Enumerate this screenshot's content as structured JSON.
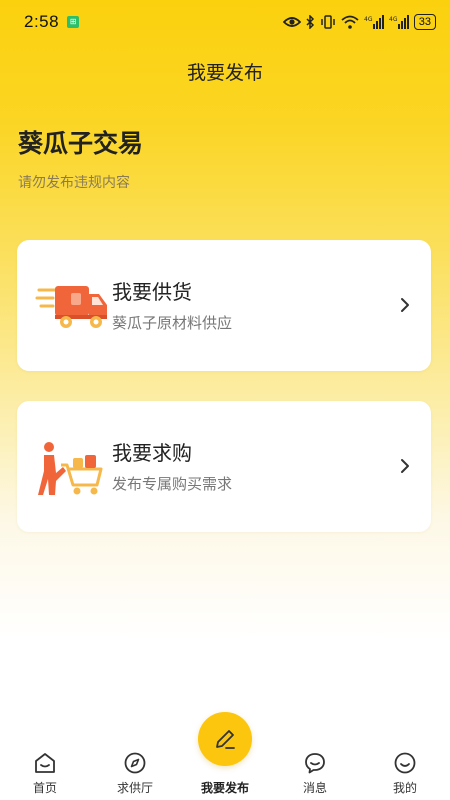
{
  "status_bar": {
    "time": "2:58",
    "battery": "33",
    "icons": [
      "notification-icon",
      "eye-icon",
      "bluetooth-icon",
      "vibrate-icon",
      "wifi-icon",
      "signal-4g-icon",
      "signal-4g-icon",
      "battery-icon"
    ]
  },
  "nav": {
    "title": "我要发布"
  },
  "header": {
    "title": "葵瓜子交易",
    "subtitle": "请勿发布违规内容"
  },
  "cards": [
    {
      "title": "我要供货",
      "desc": "葵瓜子原材料供应",
      "icon": "delivery-truck-icon"
    },
    {
      "title": "我要求购",
      "desc": "发布专属购买需求",
      "icon": "shopping-cart-icon"
    }
  ],
  "tabs": [
    {
      "label": "首页",
      "icon": "home-icon"
    },
    {
      "label": "求供厅",
      "icon": "compass-icon"
    },
    {
      "label": "我要发布",
      "icon": "pencil-icon",
      "active": true
    },
    {
      "label": "消息",
      "icon": "message-icon"
    },
    {
      "label": "我的",
      "icon": "profile-icon"
    }
  ],
  "colors": {
    "accent": "#FBC60D",
    "header_yellow": "#FBD10E",
    "icon_orange": "#F0663A"
  }
}
